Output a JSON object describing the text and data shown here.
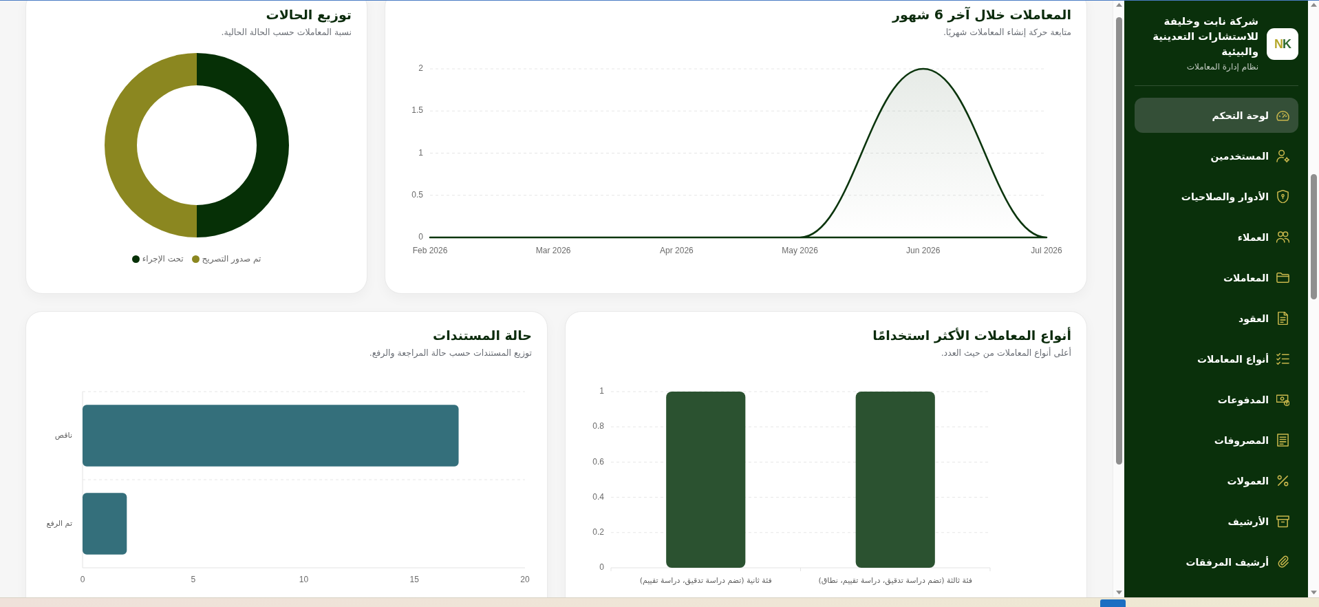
{
  "sidebar": {
    "logo_text": "NK",
    "company_name": "شركة نابت وخليفة للاستشارات التعدينية والبيئية",
    "subtitle": "نظام إدارة المعاملات",
    "items": [
      {
        "label": "لوحة التحكم",
        "selected": true
      },
      {
        "label": "المستخدمين",
        "selected": false
      },
      {
        "label": "الأدوار والصلاحيات",
        "selected": false
      },
      {
        "label": "العملاء",
        "selected": false
      },
      {
        "label": "المعاملات",
        "selected": false
      },
      {
        "label": "العقود",
        "selected": false
      },
      {
        "label": "أنواع المعاملات",
        "selected": false
      },
      {
        "label": "المدفوعات",
        "selected": false
      },
      {
        "label": "المصروفات",
        "selected": false
      },
      {
        "label": "العمولات",
        "selected": false
      },
      {
        "label": "الأرشيف",
        "selected": false
      },
      {
        "label": "أرشيف المرفقات",
        "selected": false
      }
    ]
  },
  "monthly_chart": {
    "title": "المعاملات خلال آخر 6 شهور",
    "subtitle": "متابعة حركة إنشاء المعاملات شهريًا.",
    "chart_data": {
      "type": "area",
      "x": [
        "Feb 2026",
        "Mar 2026",
        "Apr 2026",
        "May 2026",
        "Jun 2026",
        "Jul 2026"
      ],
      "series": [
        {
          "color": "#0b350d",
          "values": [
            0,
            0,
            0,
            0,
            2,
            0
          ]
        }
      ],
      "ylim": [
        0,
        2
      ],
      "yticks": [
        0,
        0.5,
        1,
        1.5,
        2
      ],
      "grid": true
    }
  },
  "status_chart": {
    "title": "توزيع الحالات",
    "subtitle": "نسبة المعاملات حسب الحالة الحالية.",
    "legend": [
      {
        "label": "تم صدور التصريح",
        "color": "#8b8720"
      },
      {
        "label": "تحت الإجراء",
        "color": "#063006"
      }
    ]
  },
  "types_chart": {
    "title": "أنواع المعاملات الأكثر استخدامًا",
    "subtitle": "أعلى أنواع المعاملات من حيث العدد.",
    "chart_data": {
      "type": "bar",
      "categories": [
        "فئة ثانية (تضم دراسة تدقيق، دراسة تقييم)",
        "فئة ثالثة (تضم دراسة تدقيق، دراسة تقييم، نطاق)"
      ],
      "series": [
        {
          "color": "#2b5230",
          "values": [
            1,
            1
          ]
        }
      ],
      "ylim": [
        0,
        1
      ],
      "yticks": [
        0,
        0.2,
        0.4,
        0.6,
        0.8,
        1
      ],
      "grid": true
    }
  },
  "documents_chart": {
    "title": "حالة المستندات",
    "subtitle": "توزيع المستندات حسب حالة المراجعة والرفع.",
    "chart_data": {
      "type": "bar",
      "orientation": "horizontal",
      "categories": [
        "ناقص",
        "تم الرفع"
      ],
      "series": [
        {
          "color": "#346f7b",
          "values": [
            17,
            2
          ]
        }
      ],
      "xlim": [
        0,
        20
      ],
      "xticks": [
        0,
        5,
        10,
        15,
        20
      ],
      "grid": true
    }
  }
}
